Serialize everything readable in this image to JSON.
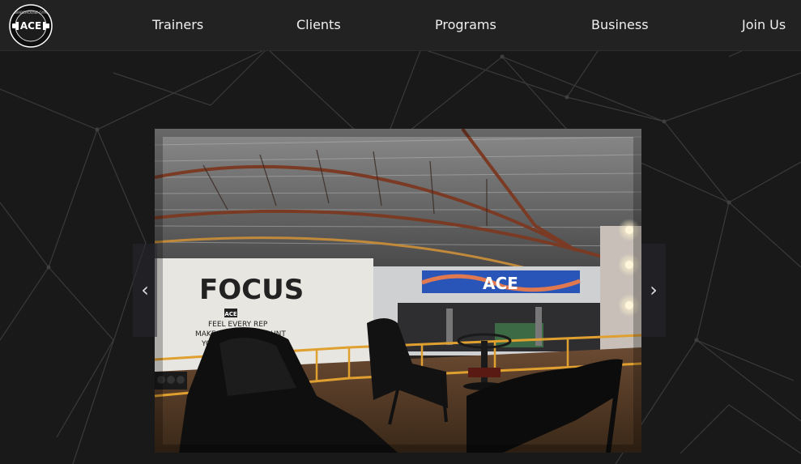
{
  "brand": {
    "logo_icon": "ace-logo-icon",
    "logo_text": "ACE",
    "logo_ring_text": "WAREHOUSE GYM"
  },
  "nav": {
    "items": [
      {
        "label": "Trainers"
      },
      {
        "label": "Clients"
      },
      {
        "label": "Programs"
      },
      {
        "label": "Business"
      },
      {
        "label": "Join Us"
      }
    ]
  },
  "carousel": {
    "prev_label": "‹",
    "next_label": "›",
    "slide": {
      "wall_text": {
        "big": "FOCUS",
        "tag": "ACE",
        "line1": "FEEL EVERY REP",
        "line2": "MAKE EVERY SET COUNT",
        "line3": "YOU'"
      },
      "banner_text": "ACE"
    }
  },
  "colors": {
    "topbar": "#222222",
    "background": "#191919",
    "nav_text": "#f0f0f0",
    "railing": "#e0a030"
  }
}
